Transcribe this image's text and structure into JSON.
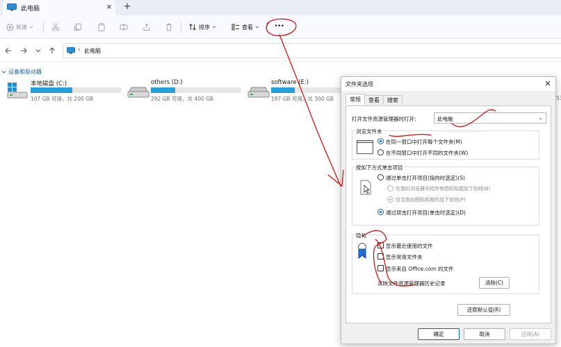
{
  "window": {
    "tab_title": "此电脑",
    "tab_close": "×",
    "new_tab": "+"
  },
  "toolbar": {
    "new_label": "新建",
    "sort_label": "排序",
    "view_label": "查看",
    "more_label": "···"
  },
  "address": {
    "chevron": "›",
    "location": "此电脑"
  },
  "content": {
    "section_title": "设备和驱动器",
    "drives": [
      {
        "name": "本地磁盘 (C:)",
        "space": "107 GB 可用，共 200 GB",
        "used_fraction": 0.465
      },
      {
        "name": "others (D:)",
        "space": "292 GB 可用，共 400 GB",
        "used_fraction": 0.27
      },
      {
        "name": "software (E:)",
        "space": "197 GB 可用，共 300 GB",
        "used_fraction": 0.34
      }
    ],
    "partial_text": "53"
  },
  "dialog": {
    "title": "文件夹选项",
    "close": "×",
    "tabs": [
      "常规",
      "查看",
      "搜索"
    ],
    "open_in_label": "打开文件资源管理器时打开:",
    "open_in_value": "此电脑",
    "browse_group": {
      "title": "浏览文件夹",
      "option_same": "在同一窗口中打开每个文件夹(M)",
      "option_new": "在不同窗口中打开不同的文件夹(W)"
    },
    "click_group": {
      "title": "按如下方式单击项目",
      "option_single": "通过单击打开项目(指向时选定)(S)",
      "option_underline_all": "在我的浏览器中给所有图标标题加下划线(B)",
      "option_underline_hover": "仅当指向图标标题时加下划线(P)",
      "option_double": "通过双击打开项目(单击时选定)(D)"
    },
    "privacy_group": {
      "title": "隐私",
      "recent_files": "显示最近使用的文件",
      "frequent_folders": "显示常用文件夹",
      "office_files": "显示来自 Office.com 的文件",
      "clear_history_label": "清除文件资源管理器历史记录",
      "clear_button": "清除(C)"
    },
    "restore_defaults": "还原默认值(R)",
    "ok": "确定",
    "cancel": "取消",
    "apply": "应用(A)"
  },
  "colors": {
    "accent": "#0b5fbf",
    "drive_fill": "#26a0da",
    "annotation": "#d41414"
  }
}
